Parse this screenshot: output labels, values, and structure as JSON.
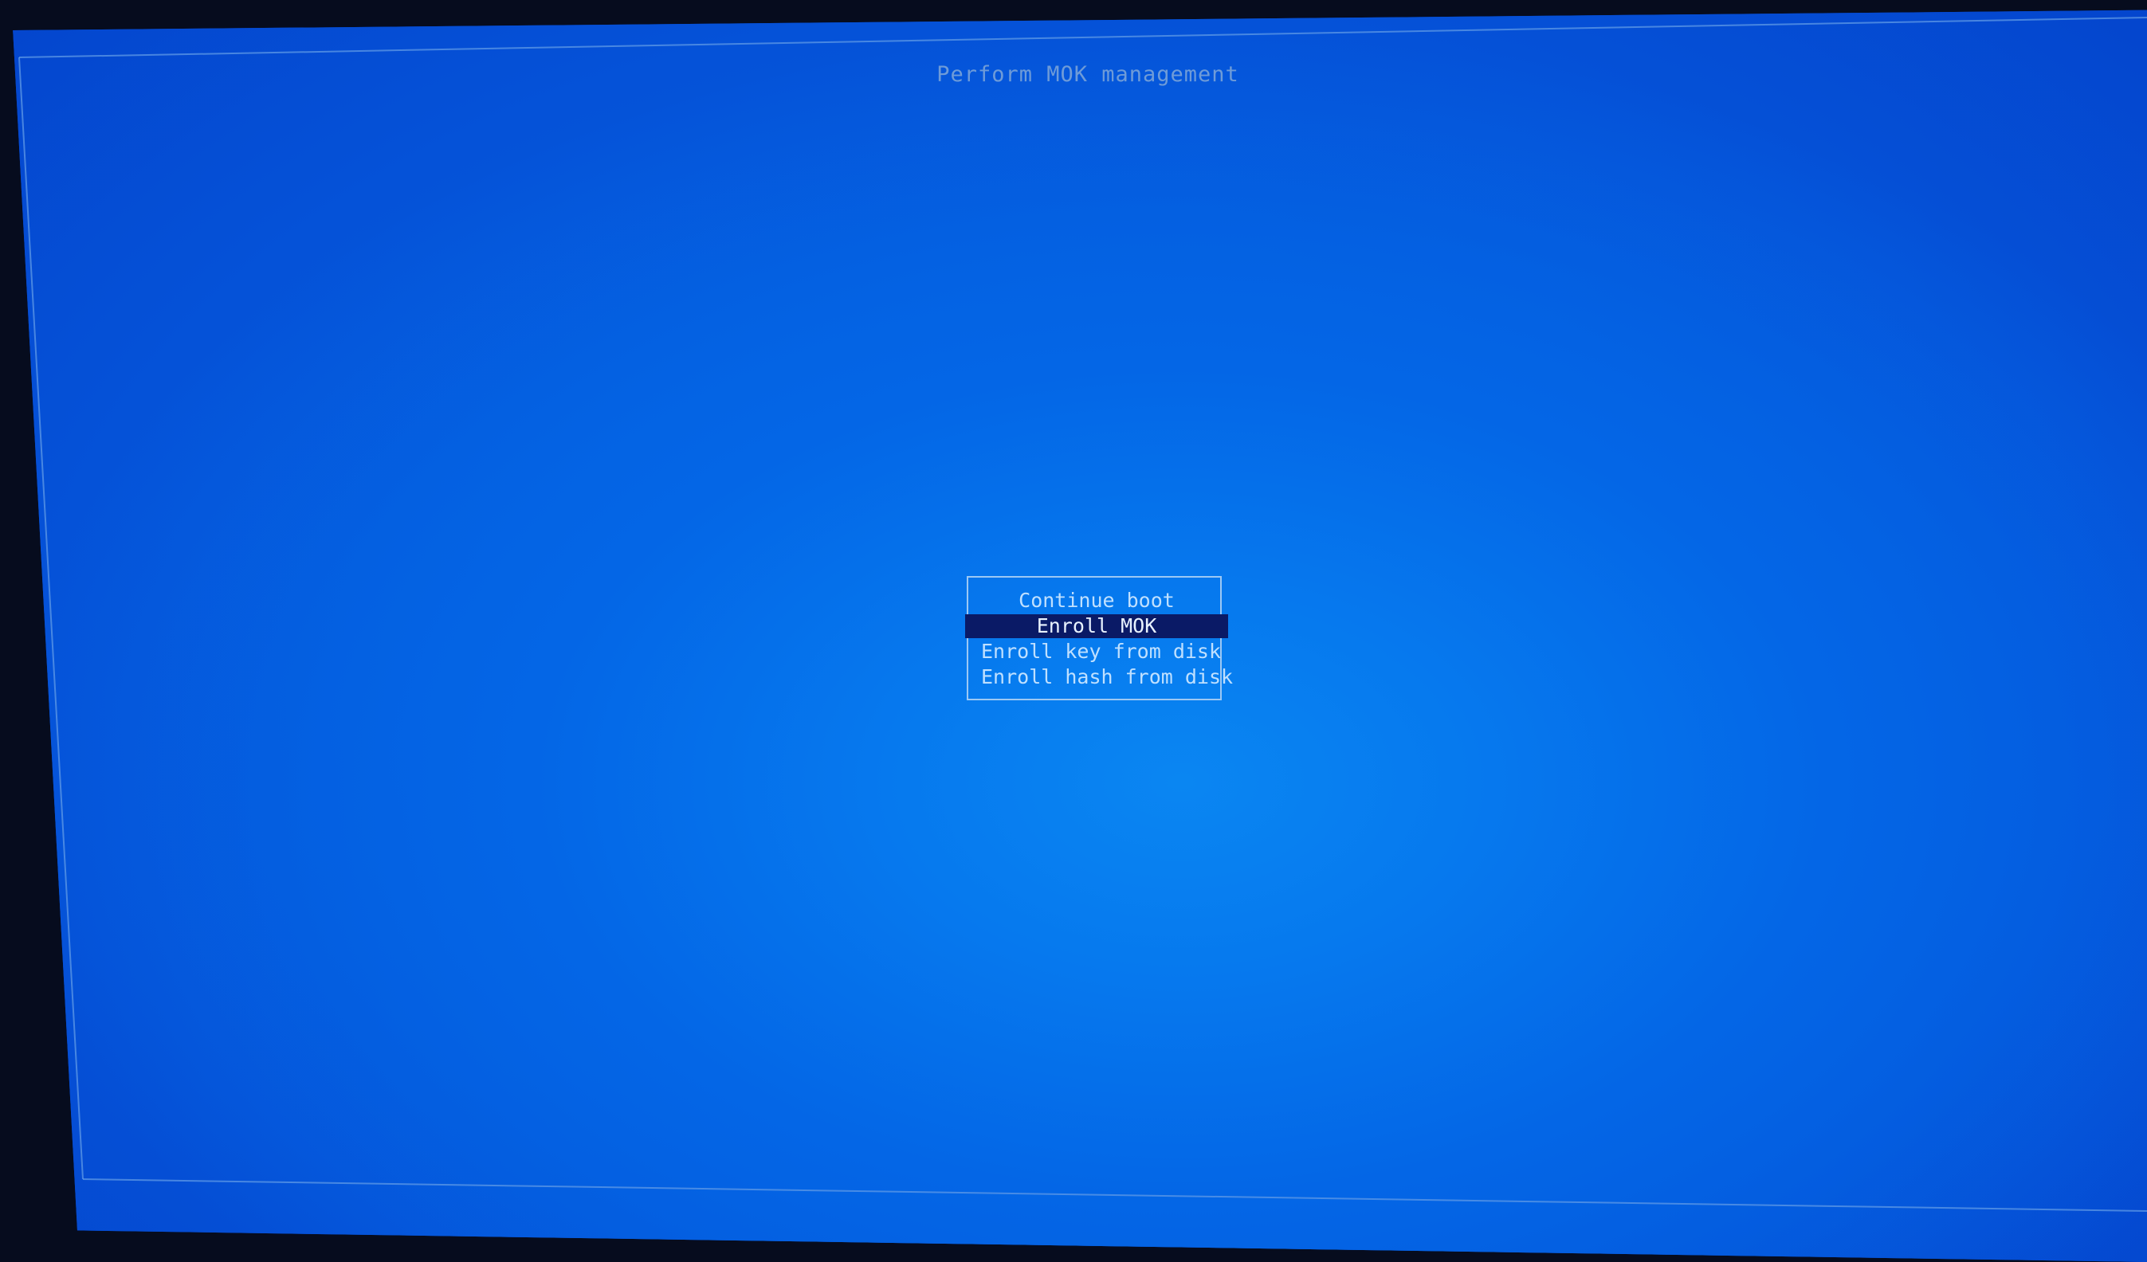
{
  "screen": {
    "title": "Perform MOK management",
    "background_color": "#0566e2",
    "frame_color": "#9cc8f4"
  },
  "menu": {
    "selected_index": 1,
    "items": [
      {
        "label": "Continue boot"
      },
      {
        "label": "Enroll MOK"
      },
      {
        "label": "Enroll key from disk"
      },
      {
        "label": "Enroll hash from disk"
      }
    ]
  }
}
